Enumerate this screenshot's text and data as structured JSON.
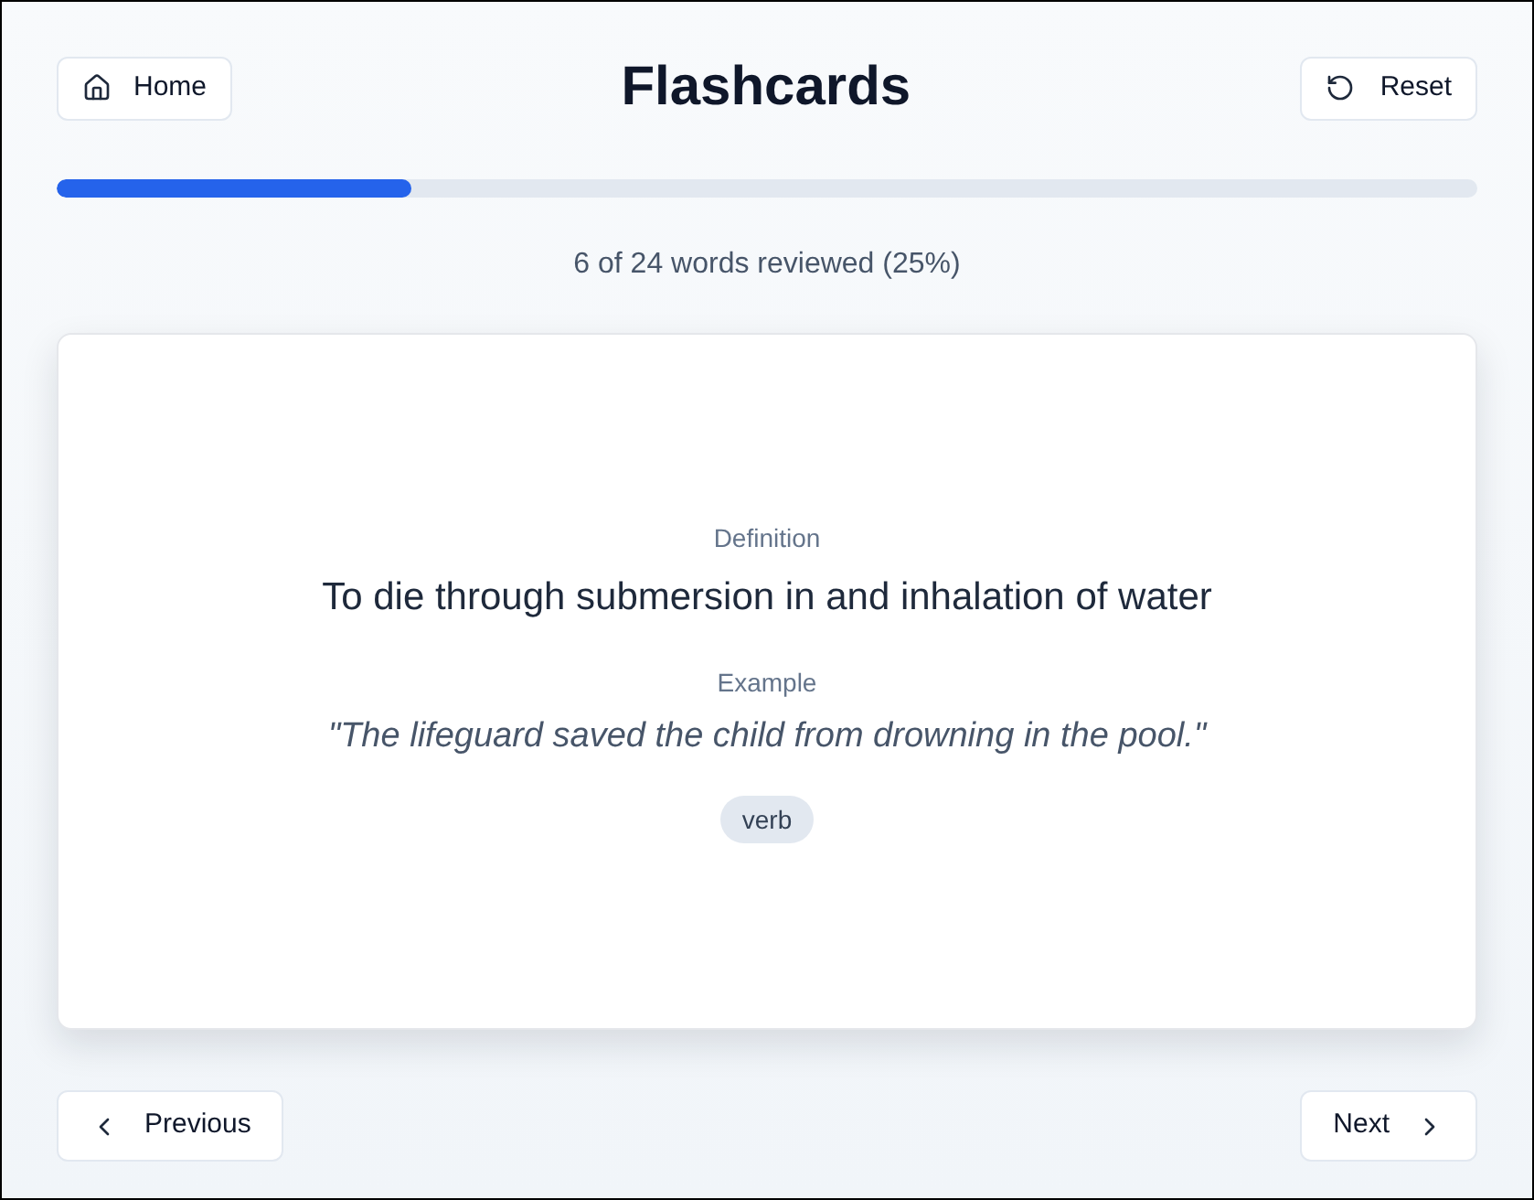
{
  "header": {
    "home_button": {
      "label": "Home"
    },
    "title": "Flashcards",
    "reset_button": {
      "label": "Reset"
    }
  },
  "progress": {
    "level": 0.25,
    "caption": "6 of 24 words reviewed (25%)"
  },
  "card": {
    "fields": [
      {
        "kind": "definition",
        "label": "Definition",
        "text": "To die through submersion in and inhalation of water"
      },
      {
        "kind": "example",
        "label": "Example",
        "text": "\"The lifeguard saved the child from drowning in the pool.\""
      }
    ],
    "part_of_speech": "verb"
  },
  "navigation": {
    "previous": {
      "label": "Previous"
    },
    "next": {
      "label": "Next"
    }
  }
}
